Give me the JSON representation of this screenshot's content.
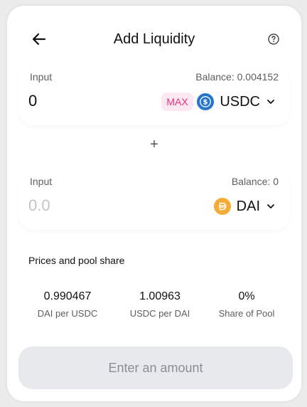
{
  "header": {
    "title": "Add Liquidity",
    "back_icon": "arrow-left-icon",
    "help_icon": "question-circle-icon"
  },
  "input_a": {
    "label": "Input",
    "balance": "Balance: 0.004152",
    "value": "0",
    "max_label": "MAX",
    "token_symbol": "USDC",
    "token_icon": "usdc-icon",
    "token_color": "#2775ca"
  },
  "separator": "+",
  "input_b": {
    "label": "Input",
    "balance": "Balance: 0",
    "placeholder": "0.0",
    "token_symbol": "DAI",
    "token_icon": "dai-icon",
    "token_color": "#f5ac37"
  },
  "prices": {
    "title": "Prices and pool share",
    "items": [
      {
        "value": "0.990467",
        "label": "DAI per USDC"
      },
      {
        "value": "1.00963",
        "label": "USDC per DAI"
      },
      {
        "value": "0%",
        "label": "Share of Pool"
      }
    ]
  },
  "action": {
    "label": "Enter an amount",
    "enabled": false
  },
  "colors": {
    "max_bg": "#fde8f1",
    "max_text": "#e8337f",
    "button_bg": "#e8e9ed",
    "button_text": "#8b8e96"
  }
}
